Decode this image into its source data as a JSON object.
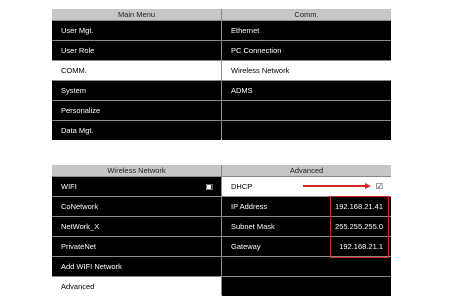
{
  "main_menu": {
    "title": "Main Menu",
    "items": [
      "User Mgt.",
      "User Role",
      "COMM.",
      "System",
      "Personalize",
      "Data Mgt."
    ]
  },
  "comm": {
    "title": "Comm.",
    "items": [
      "Ethernet",
      "PC Connection",
      "Wireless Network",
      "ADMS",
      "",
      ""
    ]
  },
  "wireless": {
    "title": "Wireless Network",
    "items": [
      "WIFI",
      "CoNetwork",
      "NetWork_X",
      "PrivateNet",
      "Add WIFI Network",
      "Advanced"
    ]
  },
  "advanced": {
    "title": "Advanced",
    "dhcp_label": "DHCP",
    "dhcp_checked": true,
    "ip_label": "IP Address",
    "ip_value": "192.168.21.41",
    "subnet_label": "Subnet Mask",
    "subnet_value": "255.255.255.0",
    "gateway_label": "Gateway",
    "gateway_value": "192.168.21.1"
  },
  "colors": {
    "highlight": "#d9262b",
    "header_bg": "#c6c6c6",
    "row_bg": "#000000"
  }
}
